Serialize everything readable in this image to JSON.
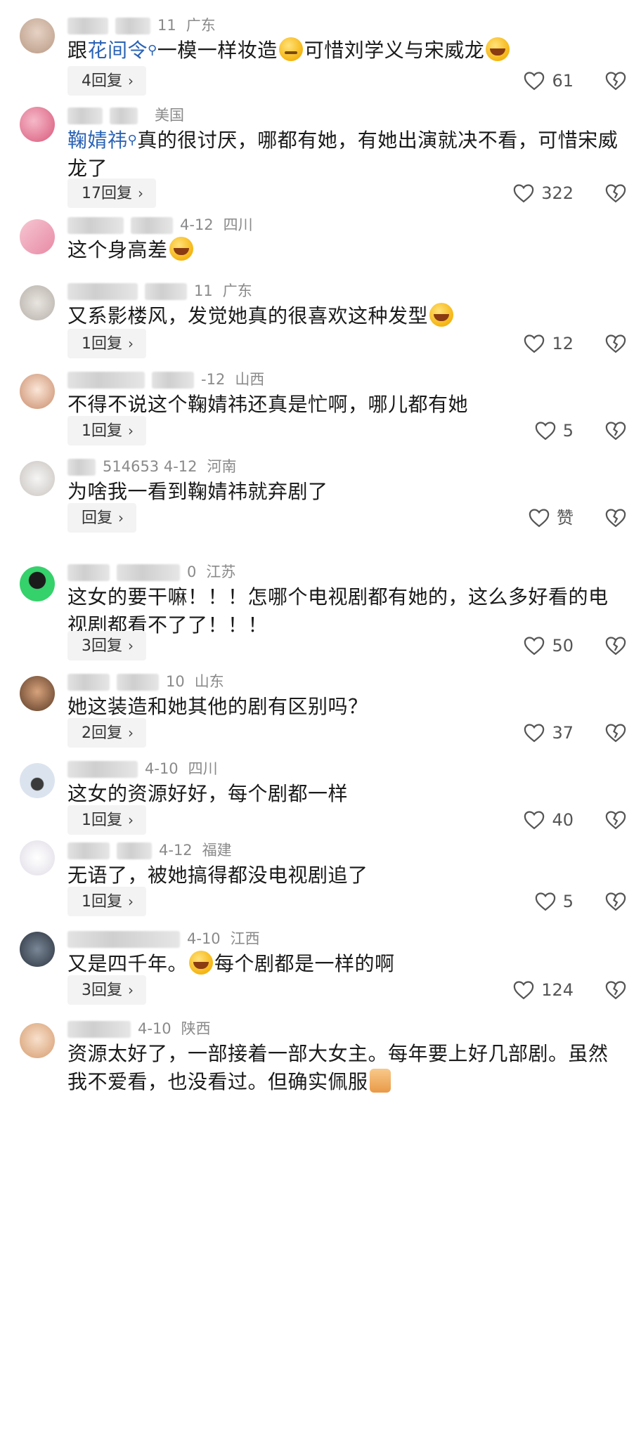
{
  "comments": [
    {
      "meta": {
        "time": "11",
        "location": "广东"
      },
      "segments": [
        {
          "t": "跟"
        },
        {
          "t": "花间令",
          "link": true
        },
        {
          "t": "一模一样妆造"
        },
        {
          "emoji": "smirk"
        },
        {
          "t": "可惜刘学义与宋威龙"
        },
        {
          "emoji": "cry"
        }
      ],
      "reply_label": "4回复",
      "likes": "61"
    },
    {
      "meta": {
        "time": "",
        "location": "美国"
      },
      "segments": [
        {
          "t": "鞠婧祎",
          "link": true
        },
        {
          "t": "真的很讨厌，哪都有她，有她出演就决不看，可惜宋威龙了"
        }
      ],
      "reply_label": "17回复",
      "likes": "322"
    },
    {
      "meta": {
        "time": "4-12",
        "location": "四川"
      },
      "segments": [
        {
          "t": "这个身高差"
        },
        {
          "emoji": "cry"
        }
      ],
      "reply_label": "",
      "likes": ""
    },
    {
      "meta": {
        "time": "11",
        "location": "广东"
      },
      "segments": [
        {
          "t": "又系影楼风，发觉她真的很喜欢这种发型"
        },
        {
          "emoji": "cry"
        }
      ],
      "reply_label": "1回复",
      "likes": "12"
    },
    {
      "meta": {
        "time": "-12",
        "location": "山西"
      },
      "segments": [
        {
          "t": "不得不说这个鞠婧祎还真是忙啊，哪儿都有她"
        }
      ],
      "reply_label": "1回复",
      "likes": "5"
    },
    {
      "meta": {
        "time": "514653  4-12",
        "location": "河南"
      },
      "segments": [
        {
          "t": "为啥我一看到鞠婧祎就弃剧了"
        }
      ],
      "reply_label": "回复",
      "likes": "赞"
    },
    {
      "meta": {
        "time": "0",
        "location": "江苏"
      },
      "segments": [
        {
          "t": "这女的要干嘛！！！怎哪个电视剧都有她的，这么多好看的电视剧都看不了了！！！"
        }
      ],
      "reply_label": "3回复",
      "likes": "50"
    },
    {
      "meta": {
        "time": "10",
        "location": "山东"
      },
      "segments": [
        {
          "t": "她这装造和她其他的剧有区别吗？"
        }
      ],
      "reply_label": "2回复",
      "likes": "37"
    },
    {
      "meta": {
        "time": "4-10",
        "location": "四川"
      },
      "segments": [
        {
          "t": "这女的资源好好，每个剧都一样"
        }
      ],
      "reply_label": "1回复",
      "likes": "40"
    },
    {
      "meta": {
        "time": "4-12",
        "location": "福建"
      },
      "segments": [
        {
          "t": "无语了，被她搞得都没电视剧追了"
        }
      ],
      "reply_label": "1回复",
      "likes": "5"
    },
    {
      "meta": {
        "time": "4-10",
        "location": "江西"
      },
      "segments": [
        {
          "t": "又是四千年。"
        },
        {
          "emoji": "cry"
        },
        {
          "t": "每个剧都是一样的啊"
        }
      ],
      "reply_label": "3回复",
      "likes": "124"
    },
    {
      "meta": {
        "time": "4-10",
        "location": "陕西"
      },
      "segments": [
        {
          "t": "资源太好了，一部接着一部大女主。每年要上好几部剧。虽然我不爱看，也没看过。但确实佩服"
        },
        {
          "emoji": "thumb"
        }
      ],
      "reply_label": "",
      "likes": ""
    }
  ],
  "colors": {
    "link": "#2b63b5",
    "meta": "#8a8a8a",
    "text": "#1a1a1a",
    "reply_bg": "#f3f3f3"
  },
  "icons": {
    "like": "heart-outline-icon",
    "dislike": "broken-heart-icon",
    "chevron": "chevron-right-icon"
  }
}
